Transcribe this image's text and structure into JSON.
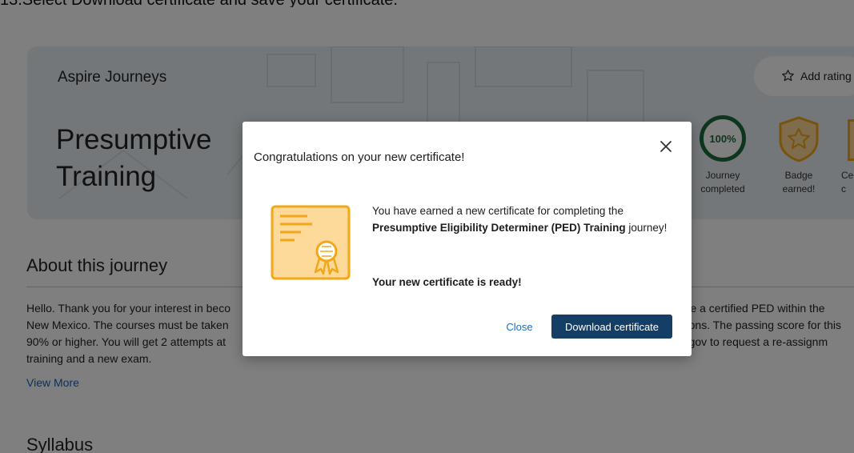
{
  "instruction": "13.Select Download certificate and save your certificate.",
  "hero": {
    "eyebrow": "Aspire Journeys",
    "title_line1": "Presumptive",
    "title_line2": "Training",
    "rating_label": "Add rating"
  },
  "stats": {
    "journey_percent": "100%",
    "journey_label_1": "Journey",
    "journey_label_2": "completed",
    "badge_label_1": "Badge",
    "badge_label_2": "earned!",
    "cert_label_1": "Ce",
    "cert_label_2": "c"
  },
  "about": {
    "heading": "About this journey",
    "line1_left": "Hello. Thank you for your interest in beco",
    "line1_right": "come a certified PED within the",
    "line2_left": "New Mexico. The courses must be taken",
    "line2_right": "ons. The passing score for this",
    "line3_left": "90% or higher. You will get 2 attempts at",
    "line3_right": "m.gov to request a re-assignm",
    "line4": "training and a new exam.",
    "view_more": "View More"
  },
  "syllabus": {
    "heading": "Syllabus"
  },
  "modal": {
    "title": "Congratulations on your new certificate!",
    "body_prefix": "You have earned a new certificate for completing the",
    "journey_name": "Presumptive Eligibility Determiner (PED) Training",
    "body_suffix": "journey!",
    "ready": "Your new certificate is ready!",
    "close_label": "Close",
    "download_label": "Download certificate"
  },
  "colors": {
    "accent": "#143e66",
    "link": "#1a6ec0",
    "cert_orange": "#f2a719",
    "cert_fill": "#fdd99a",
    "success_green": "#1d6b3b"
  }
}
